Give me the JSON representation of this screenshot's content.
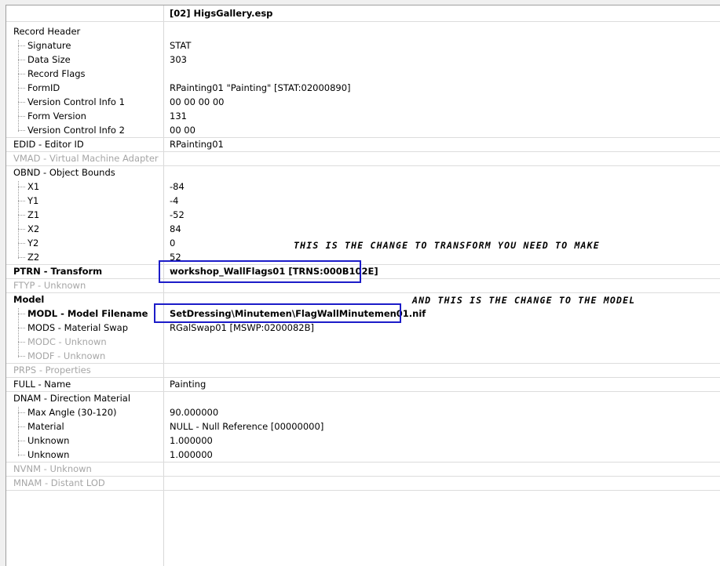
{
  "header": {
    "plugin_title": "[02] HigsGallery.esp"
  },
  "rows": {
    "record_header": {
      "name": "Record Header",
      "value": ""
    },
    "signature": {
      "name": "Signature",
      "value": "STAT"
    },
    "data_size": {
      "name": "Data Size",
      "value": "303"
    },
    "record_flags": {
      "name": "Record Flags",
      "value": ""
    },
    "formid": {
      "name": "FormID",
      "value": "RPainting01 \"Painting\" [STAT:02000890]"
    },
    "vci1": {
      "name": "Version Control Info 1",
      "value": "00 00 00 00"
    },
    "form_version": {
      "name": "Form Version",
      "value": "131"
    },
    "vci2": {
      "name": "Version Control Info 2",
      "value": "00 00"
    },
    "edid": {
      "name": "EDID - Editor ID",
      "value": "RPainting01"
    },
    "vmad": {
      "name": "VMAD - Virtual Machine Adapter",
      "value": ""
    },
    "obnd": {
      "name": "OBND - Object Bounds",
      "value": ""
    },
    "x1": {
      "name": "X1",
      "value": "-84"
    },
    "y1": {
      "name": "Y1",
      "value": "-4"
    },
    "z1": {
      "name": "Z1",
      "value": "-52"
    },
    "x2": {
      "name": "X2",
      "value": "84"
    },
    "y2": {
      "name": "Y2",
      "value": "0"
    },
    "z2": {
      "name": "Z2",
      "value": "52"
    },
    "ptrn": {
      "name": "PTRN - Transform",
      "value": "workshop_WallFlags01 [TRNS:000B102E]"
    },
    "ftyp": {
      "name": "FTYP - Unknown",
      "value": ""
    },
    "model": {
      "name": "Model",
      "value": ""
    },
    "modl": {
      "name": "MODL - Model Filename",
      "value": "SetDressing\\Minutemen\\FlagWallMinutemen01.nif"
    },
    "mods": {
      "name": "MODS - Material Swap",
      "value": "RGalSwap01 [MSWP:0200082B]"
    },
    "modc": {
      "name": "MODC - Unknown",
      "value": ""
    },
    "modf": {
      "name": "MODF - Unknown",
      "value": ""
    },
    "prps": {
      "name": "PRPS - Properties",
      "value": ""
    },
    "full": {
      "name": "FULL - Name",
      "value": "Painting"
    },
    "dnam": {
      "name": "DNAM - Direction Material",
      "value": ""
    },
    "max_angle": {
      "name": "Max Angle (30-120)",
      "value": "90.000000"
    },
    "material": {
      "name": "Material",
      "value": "NULL - Null Reference [00000000]"
    },
    "unknown1": {
      "name": "Unknown",
      "value": "1.000000"
    },
    "unknown2": {
      "name": "Unknown",
      "value": "1.000000"
    },
    "nvnm": {
      "name": "NVNM - Unknown",
      "value": ""
    },
    "mnam": {
      "name": "MNAM - Distant LOD",
      "value": ""
    }
  },
  "annotations": {
    "transform_note": "THIS IS THE CHANGE TO TRANSFORM YOU NEED TO MAKE",
    "model_note": "AND THIS IS THE CHANGE TO THE MODEL"
  },
  "colors": {
    "highlight_box": "#1c1cc8",
    "muted_text": "#a6a6a6"
  }
}
